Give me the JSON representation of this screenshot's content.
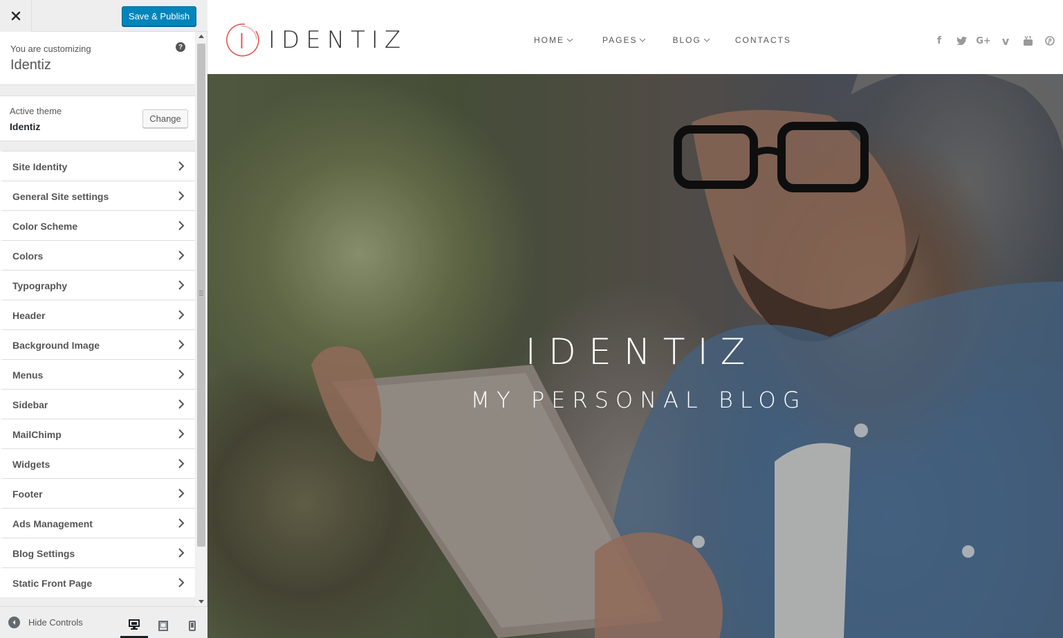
{
  "customizer": {
    "save_label": "Save & Publish",
    "customizing_label": "You are customizing",
    "site_name": "Identiz",
    "active_theme_label": "Active theme",
    "active_theme_name": "Identiz",
    "change_label": "Change",
    "help_glyph": "?",
    "sections": [
      {
        "label": "Site Identity"
      },
      {
        "label": "General Site settings"
      },
      {
        "label": "Color Scheme"
      },
      {
        "label": "Colors"
      },
      {
        "label": "Typography"
      },
      {
        "label": "Header"
      },
      {
        "label": "Background Image"
      },
      {
        "label": "Menus"
      },
      {
        "label": "Sidebar"
      },
      {
        "label": "MailChimp"
      },
      {
        "label": "Widgets"
      },
      {
        "label": "Footer"
      },
      {
        "label": "Ads Management"
      },
      {
        "label": "Blog Settings"
      },
      {
        "label": "Static Front Page"
      }
    ],
    "hide_controls_label": "Hide Controls",
    "devices": [
      "desktop-icon",
      "tablet-icon",
      "mobile-icon"
    ],
    "active_device": "desktop"
  },
  "preview": {
    "logo_letter": "I",
    "logo_text": "IDENTIZ",
    "nav": [
      {
        "label": "HOME",
        "has_dropdown": true
      },
      {
        "label": "PAGES",
        "has_dropdown": true
      },
      {
        "label": "BLOG",
        "has_dropdown": true
      },
      {
        "label": "CONTACTS",
        "has_dropdown": false
      }
    ],
    "social_icons": [
      "facebook-icon",
      "twitter-icon",
      "google-plus-icon",
      "vimeo-icon",
      "youtube-icon",
      "pinterest-icon"
    ],
    "social_glyphs": {
      "facebook": "f",
      "twitter": "t",
      "google_plus": "G+",
      "vimeo": "v",
      "youtube": "▶",
      "pinterest": "P"
    },
    "hero_title": "IDENTIZ",
    "hero_subtitle": "MY PERSONAL BLOG"
  },
  "colors": {
    "primary_button": "#0085ba",
    "logo_accent": "#e45454",
    "sidebar_bg": "#eeeeee"
  }
}
